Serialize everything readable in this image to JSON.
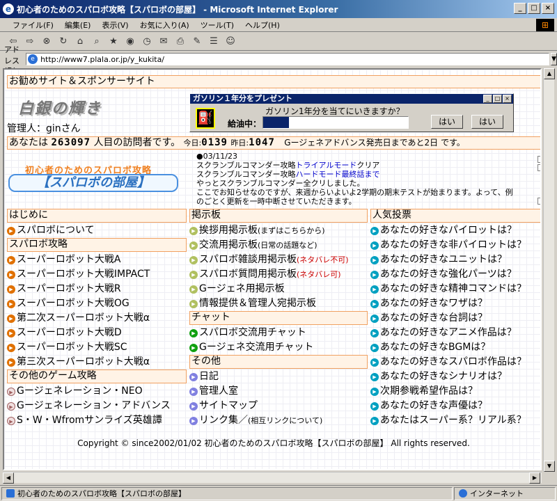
{
  "window": {
    "title": "初心者のためのスパロボ攻略【スパロボの部屋】 - Microsoft Internet Explorer"
  },
  "menu": [
    "ファイル(F)",
    "編集(E)",
    "表示(V)",
    "お気に入り(A)",
    "ツール(T)",
    "ヘルプ(H)"
  ],
  "address": {
    "label": "アドレス(D)",
    "url": "http://www7.plala.or.jp/y_kukita/"
  },
  "page": {
    "sponsor_bar": "お勧めサイト＆スポンサーサイト",
    "logo_text": "白銀の輝き",
    "admin": "管理人：ginさん",
    "popup": {
      "title": "ガソリン１年分をプレゼント",
      "question": "ガソリン1年分を当てにいきますか？",
      "label": "給油中：",
      "progress": 0.18,
      "btn1": "はい",
      "btn2": "はい"
    },
    "visitor": {
      "pre": "あなたは",
      "count": "263097",
      "post": "人目の訪問者です。",
      "today_label": "今日:",
      "today": "0139",
      "yesterday_label": "昨日:",
      "yesterday": "1047",
      "notice": "Gージェネアドバンス発売日まであと2日 です。"
    },
    "site_logo": {
      "sub": "初心者のためのスパロボ攻略",
      "main": "【スパロボの部屋】"
    },
    "news": {
      "date": "●03/11/23",
      "line1_pre": "スクランブルコマンダー攻略",
      "line1_link": "トライアルモード",
      "line1_post": "クリア",
      "line2_pre": "スクランブルコマンダー攻略",
      "line2_link": "ハードモード最終話まで",
      "line3": "やっとスクランブルコマンダー全クリしました。",
      "line4": "ここでお知らせなのですが、来週からいよいよ2学期の期末テストが始まります。よって、例",
      "line5": "のごとく更新を一時中断させていただきます。"
    },
    "col1": {
      "sec1": "はじめに",
      "sec1_items": [
        "スパロボについて"
      ],
      "sec2": "スパロボ攻略",
      "sec2_items": [
        "スーパーロボット大戦A",
        "スーパーロボット大戦IMPACT",
        "スーパーロボット大戦R",
        "スーパーロボット大戦OG",
        "第二次スーパーロボット大戦α",
        "スーパーロボット大戦D",
        "スーパーロボット大戦SC",
        "第三次スーパーロボット大戦α"
      ],
      "sec3": "その他のゲーム攻略",
      "sec3_items": [
        "Gージェネレーション・NEO",
        "Gージェネレーション・アドバンス",
        "S・W・Wfromサンライズ英雄譚"
      ]
    },
    "col2": {
      "sec1": "掲示板",
      "bbs": [
        {
          "main": "挨拶用掲示板",
          "note": "(まずはこちらから)",
          "red": ""
        },
        {
          "main": "交流用掲示板",
          "note": "(日常の話題など)",
          "red": ""
        },
        {
          "main": "スパロボ雑談用掲示板",
          "note": "",
          "red": "(ネタバレ不可)"
        },
        {
          "main": "スパロボ質問用掲示板",
          "note": "",
          "red": "(ネタバレ可)"
        },
        {
          "main": "Gージェネ用掲示板",
          "note": "",
          "red": ""
        },
        {
          "main": "情報提供＆管理人宛掲示板",
          "note": "",
          "red": ""
        }
      ],
      "sec2": "チャット",
      "chat": [
        "スパロボ交流用チャット",
        "Gージェネ交流用チャット"
      ],
      "sec3": "その他",
      "other": [
        "日記",
        "管理人室",
        "サイトマップ"
      ],
      "link_main": "リンク集／",
      "link_note": "(相互リンクについて)"
    },
    "col3": {
      "sec1": "人気投票",
      "polls": [
        "あなたの好きなパイロットは？",
        "あなたの好きな非パイロットは？",
        "あなたの好きなユニットは？",
        "あなたの好きな強化パーツは？",
        "あなたの好きな精神コマンドは？",
        "あなたの好きなワザは？",
        "あなたの好きな台詞は？",
        "あなたの好きなアニメ作品は？",
        "あなたの好きなBGMは？",
        "あなたの好きなスパロボ作品は？",
        "あなたの好きなシナリオは？",
        "次期参戦希望作品は？",
        "あなたの好きな声優は？",
        "あなたはスーパー系？リアル系？"
      ]
    },
    "copyright": "Copyright © since2002/01/02 初心者のためのスパロボ攻略【スパロボの部屋】 All rights reserved."
  },
  "status": {
    "left": "初心者のためのスパロボ攻略【スパロボの部屋】",
    "zone": "インターネット"
  }
}
